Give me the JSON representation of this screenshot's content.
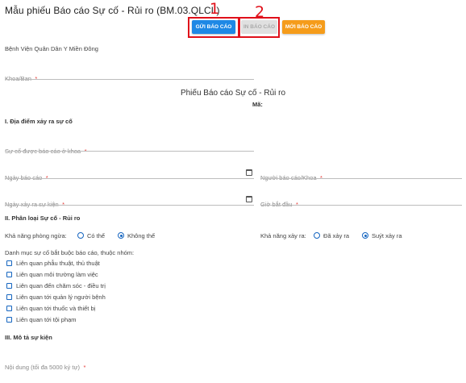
{
  "header": {
    "title": "Mẫu phiếu Báo cáo Sự cố - Rủi ro (BM.03.QLCL)"
  },
  "toolbar": {
    "send_label": "GỬI BÁO CÁO",
    "print_label": "IN BÁO CÁO",
    "new_label": "MỚI BÁO CÁO"
  },
  "annotations": {
    "marker_1": "1",
    "marker_2": "2",
    "color": "#e0101a"
  },
  "form": {
    "hospital": "Bệnh Viện Quân Dân Y Miền Đông",
    "department": {
      "label": "Khoa/Ban",
      "required": "*"
    },
    "title": "Phiếu Báo cáo Sự cố - Rủi ro",
    "code_label": "Mã:",
    "section1": {
      "heading": "I. Địa điểm xảy ra sự cố",
      "reported_at_dept": {
        "label": "Sự cố được báo cáo ở khoa",
        "required": "*"
      },
      "report_date": {
        "label": "Ngày báo cáo",
        "required": "*"
      },
      "reporter": {
        "label": "Người báo cáo/Khoa",
        "required": "*"
      },
      "incident_date": {
        "label": "Ngày xảy ra sự kiện",
        "required": "*"
      },
      "start_time": {
        "label": "Giờ bắt đầu",
        "required": "*"
      }
    },
    "section2": {
      "heading": "II. Phân loại Sự cố - Rủi ro",
      "preventable": {
        "label": "Khả năng phòng ngừa:",
        "options": [
          "Có thể",
          "Không thể"
        ],
        "selected": "Không thể"
      },
      "occurrence": {
        "label": "Khả năng xảy ra:",
        "options": [
          "Đã xảy ra",
          "Suýt xảy ra"
        ],
        "selected": "Suýt xảy ra"
      },
      "category_prompt": "Danh mục sự cố bắt buộc báo cáo, thuộc nhóm:",
      "categories": [
        "Liên quan phẫu thuật, thủ thuật",
        "Liên quan môi trường làm việc",
        "Liên quan đến chăm sóc - điều trị",
        "Liên quan tới quản lý người bệnh",
        "Liên quan tới thuốc và thiết bị",
        "Liên quan tới tội phạm"
      ]
    },
    "section3": {
      "heading": "III. Mô tả sự kiện",
      "content": {
        "label": "Nội dung (tối đa 5000 ký tự)",
        "required": "*"
      }
    }
  }
}
